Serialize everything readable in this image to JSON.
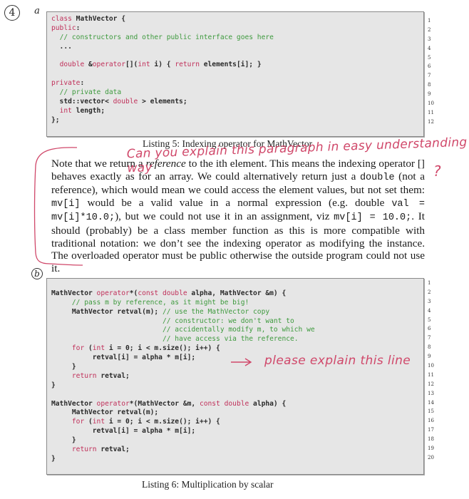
{
  "markers": {
    "problem_number": "4",
    "part_a": "a",
    "part_b": "b"
  },
  "listing5": {
    "code_lines": [
      [
        {
          "t": "class",
          "c": "kw"
        },
        {
          "t": " MathVector {",
          "c": ""
        }
      ],
      [
        {
          "t": "public",
          "c": "kw"
        },
        {
          "t": ":",
          "c": ""
        }
      ],
      [
        {
          "t": "  ",
          "c": ""
        },
        {
          "t": "// constructors and other public interface goes here",
          "c": "cm"
        }
      ],
      [
        {
          "t": "  ...",
          "c": ""
        }
      ],
      [
        {
          "t": "",
          "c": ""
        }
      ],
      [
        {
          "t": "  ",
          "c": ""
        },
        {
          "t": "double",
          "c": "kw"
        },
        {
          "t": " &",
          "c": ""
        },
        {
          "t": "operator",
          "c": "kw"
        },
        {
          "t": "[](",
          "c": ""
        },
        {
          "t": "int",
          "c": "kw"
        },
        {
          "t": " i) { ",
          "c": ""
        },
        {
          "t": "return",
          "c": "kw"
        },
        {
          "t": " elements[i]; }",
          "c": ""
        }
      ],
      [
        {
          "t": "",
          "c": ""
        }
      ],
      [
        {
          "t": "private",
          "c": "kw"
        },
        {
          "t": ":",
          "c": ""
        }
      ],
      [
        {
          "t": "  ",
          "c": ""
        },
        {
          "t": "// private data",
          "c": "cm"
        }
      ],
      [
        {
          "t": "  std::vector< ",
          "c": ""
        },
        {
          "t": "double",
          "c": "kw"
        },
        {
          "t": " > elements;",
          "c": ""
        }
      ],
      [
        {
          "t": "  ",
          "c": ""
        },
        {
          "t": "int",
          "c": "kw"
        },
        {
          "t": " length;",
          "c": ""
        }
      ],
      [
        {
          "t": "};",
          "c": ""
        }
      ]
    ],
    "line_numbers": [
      "1",
      "2",
      "3",
      "4",
      "5",
      "6",
      "7",
      "8",
      "9",
      "10",
      "11",
      "12"
    ],
    "caption": "Listing 5: Indexing operator for MathVector"
  },
  "paragraph": {
    "segments": [
      {
        "t": "Note that we return a ",
        "s": ""
      },
      {
        "t": "reference",
        "s": "em"
      },
      {
        "t": " to the ith element. This means the indexing operator [] behaves exactly as for an array. We could alternatively return just a ",
        "s": ""
      },
      {
        "t": "double",
        "s": "tt"
      },
      {
        "t": " (not a reference), which would mean we could access the element values, but not set them: ",
        "s": ""
      },
      {
        "t": "mv[i]",
        "s": "tt"
      },
      {
        "t": " would be a valid value in a normal expression (e.g. double ",
        "s": ""
      },
      {
        "t": "val = mv[i]*10.0;",
        "s": "tt"
      },
      {
        "t": "), but we could not use it in an assignment, viz ",
        "s": ""
      },
      {
        "t": "mv[i] = 10.0;",
        "s": "tt"
      },
      {
        "t": ". It should (probably) be a class member function as this is more compatible with traditional notation: we don’t see the indexing operator as modifying the instance. The overloaded operator must be public otherwise the outside program could not use it.",
        "s": ""
      }
    ]
  },
  "listing6": {
    "code_lines": [
      [
        {
          "t": "",
          "c": ""
        }
      ],
      [
        {
          "t": "MathVector ",
          "c": ""
        },
        {
          "t": "operator",
          "c": "kw"
        },
        {
          "t": "*(",
          "c": ""
        },
        {
          "t": "const double",
          "c": "kw"
        },
        {
          "t": " alpha, MathVector &m) {",
          "c": ""
        }
      ],
      [
        {
          "t": "     ",
          "c": ""
        },
        {
          "t": "// pass m by reference, as it might be big!",
          "c": "cm"
        }
      ],
      [
        {
          "t": "     MathVector retval(m); ",
          "c": ""
        },
        {
          "t": "// use the MathVector copy",
          "c": "cm"
        }
      ],
      [
        {
          "t": "                           ",
          "c": ""
        },
        {
          "t": "// constructor: we don't want to",
          "c": "cm"
        }
      ],
      [
        {
          "t": "                           ",
          "c": ""
        },
        {
          "t": "// accidentally modify m, to which we",
          "c": "cm"
        }
      ],
      [
        {
          "t": "                           ",
          "c": ""
        },
        {
          "t": "// have access via the reference.",
          "c": "cm"
        }
      ],
      [
        {
          "t": "     ",
          "c": ""
        },
        {
          "t": "for",
          "c": "kw"
        },
        {
          "t": " (",
          "c": ""
        },
        {
          "t": "int",
          "c": "kw"
        },
        {
          "t": " i = 0; i < m.size(); i++) {",
          "c": ""
        }
      ],
      [
        {
          "t": "          retval[i] = alpha * m[i];",
          "c": ""
        }
      ],
      [
        {
          "t": "     }",
          "c": ""
        }
      ],
      [
        {
          "t": "     ",
          "c": ""
        },
        {
          "t": "return",
          "c": "kw"
        },
        {
          "t": " retval;",
          "c": ""
        }
      ],
      [
        {
          "t": "}",
          "c": ""
        }
      ],
      [
        {
          "t": "",
          "c": ""
        }
      ],
      [
        {
          "t": "MathVector ",
          "c": ""
        },
        {
          "t": "operator",
          "c": "kw"
        },
        {
          "t": "*(MathVector &m, ",
          "c": ""
        },
        {
          "t": "const double",
          "c": "kw"
        },
        {
          "t": " alpha) {",
          "c": ""
        }
      ],
      [
        {
          "t": "     MathVector retval(m);",
          "c": ""
        }
      ],
      [
        {
          "t": "     ",
          "c": ""
        },
        {
          "t": "for",
          "c": "kw"
        },
        {
          "t": " (",
          "c": ""
        },
        {
          "t": "int",
          "c": "kw"
        },
        {
          "t": " i = 0; i < m.size(); i++) {",
          "c": ""
        }
      ],
      [
        {
          "t": "          retval[i] = alpha * m[i];",
          "c": ""
        }
      ],
      [
        {
          "t": "     }",
          "c": ""
        }
      ],
      [
        {
          "t": "     ",
          "c": ""
        },
        {
          "t": "return",
          "c": "kw"
        },
        {
          "t": " retval;",
          "c": ""
        }
      ],
      [
        {
          "t": "}",
          "c": ""
        }
      ]
    ],
    "line_numbers": [
      "1",
      "2",
      "3",
      "4",
      "5",
      "6",
      "7",
      "8",
      "9",
      "10",
      "11",
      "12",
      "13",
      "14",
      "15",
      "16",
      "17",
      "18",
      "19",
      "20"
    ],
    "caption": "Listing 6: Multiplication by scalar"
  },
  "annotations": {
    "question_top": "Can you explain this paragraph in easy understanding way",
    "question_mark": "?",
    "question_line": "please explain this line",
    "ink_color": "#d0486a"
  },
  "colors": {
    "keyword": "#c0305a",
    "comment": "#3e9a3e",
    "code_bg": "#e6e6e6"
  }
}
